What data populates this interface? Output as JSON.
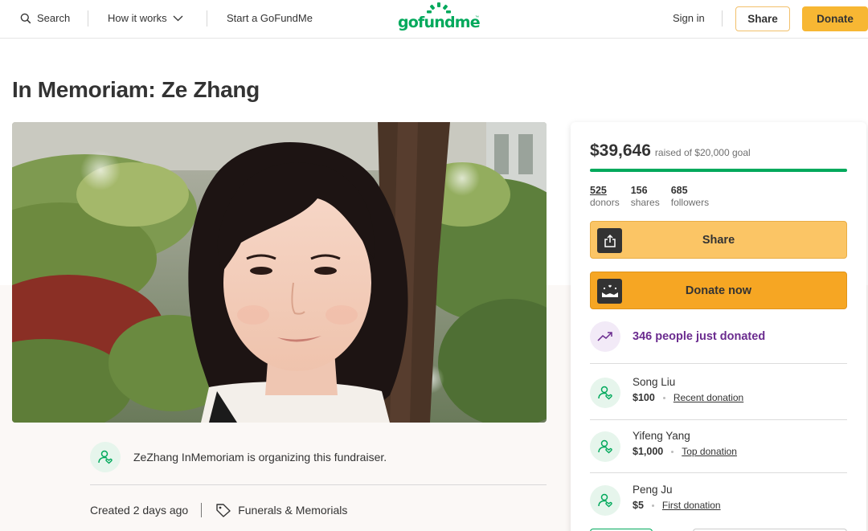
{
  "nav": {
    "search_label": "Search",
    "how_it_works_label": "How it works",
    "start_label": "Start a GoFundMe",
    "logo_text": "gofundme",
    "logo_tm": "™",
    "sign_in_label": "Sign in",
    "share_label": "Share",
    "donate_label": "Donate"
  },
  "campaign": {
    "title": "In Memoriam: Ze Zhang",
    "organizer_text": "ZeZhang InMemoriam is organizing this fundraiser.",
    "created_text": "Created 2 days ago",
    "category": "Funerals & Memorials"
  },
  "sidebar": {
    "raised_amount": "$39,646",
    "goal_text": "raised of $20,000 goal",
    "progress_fraction": 1.0,
    "stats": [
      {
        "num": "525",
        "label": "donors"
      },
      {
        "num": "156",
        "label": "shares"
      },
      {
        "num": "685",
        "label": "followers"
      }
    ],
    "share_button": "Share",
    "donate_button": "Donate now",
    "recent_activity": "346 people just donated",
    "donations": [
      {
        "name": "Song Liu",
        "amount": "$100",
        "tag": "Recent donation"
      },
      {
        "name": "Yifeng Yang",
        "amount": "$1,000",
        "tag": "Top donation"
      },
      {
        "name": "Peng Ju",
        "amount": "$5",
        "tag": "First donation"
      }
    ]
  },
  "colors": {
    "brand_green": "#02a95c",
    "donate_orange": "#f6a623",
    "share_yellow": "#fbc565",
    "activity_purple": "#6b2c8f"
  }
}
